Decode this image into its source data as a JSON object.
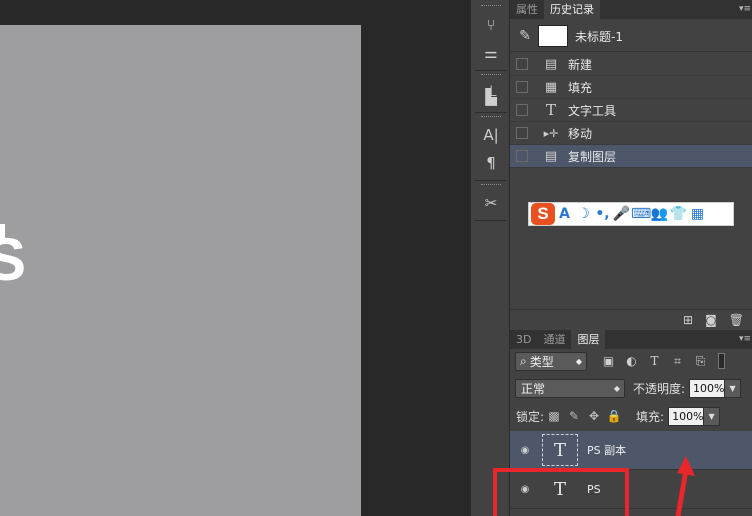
{
  "canvas": {
    "glyph": "S"
  },
  "dock": {
    "buttons": [
      {
        "name": "brush-preset-icon",
        "glyph": "⑂"
      },
      {
        "name": "adjust-sliders-icon",
        "glyph": "⚌"
      },
      {
        "name": "clone-source-icon",
        "glyph": "⊥"
      },
      {
        "name": "stamp-icon",
        "glyph": "▙"
      },
      {
        "name": "character-panel-icon",
        "glyph": "A|"
      },
      {
        "name": "paragraph-panel-icon",
        "glyph": "¶"
      },
      {
        "name": "tool-preset-icon",
        "glyph": "✂"
      }
    ]
  },
  "history_panel": {
    "tabs": [
      "属性",
      "历史记录"
    ],
    "active_tab": "历史记录",
    "snapshot_label": "未标题-1",
    "items": [
      {
        "label": "新建",
        "icon": "document-icon",
        "glyph": "▤",
        "selected": false
      },
      {
        "label": "填充",
        "icon": "fill-icon",
        "glyph": "▦",
        "selected": false
      },
      {
        "label": "文字工具",
        "icon": "type-tool-icon",
        "glyph": "T",
        "selected": false
      },
      {
        "label": "移动",
        "icon": "move-tool-icon",
        "glyph": "▸✛",
        "selected": false
      },
      {
        "label": "复制图层",
        "icon": "duplicate-layer-icon",
        "glyph": "▤",
        "selected": true
      }
    ],
    "footer_icons": [
      "new-document-from-state-icon",
      "camera-icon",
      "trash-icon"
    ]
  },
  "ime_toolbar": {
    "logo": "S",
    "icons": [
      "A",
      "☽",
      "•,",
      "🎤",
      "⌨",
      "👥",
      "👕",
      "▦"
    ]
  },
  "layers_panel": {
    "tabs": [
      "3D",
      "通道",
      "图层"
    ],
    "active_tab": "图层",
    "filter_label": "类型",
    "blend_mode": "正常",
    "opacity_label": "不透明度:",
    "opacity_value": "100%",
    "lock_label": "锁定:",
    "fill_label": "填充:",
    "fill_value": "100%",
    "layers": [
      {
        "name": "PS 副本",
        "type": "text",
        "selected": true
      },
      {
        "name": "PS",
        "type": "text",
        "selected": false
      }
    ]
  },
  "colors": {
    "annotation_red": "#e8262b",
    "selection_blue": "#4d5769",
    "canvas_gray": "#9e9da0",
    "panel_bg": "#424242"
  }
}
